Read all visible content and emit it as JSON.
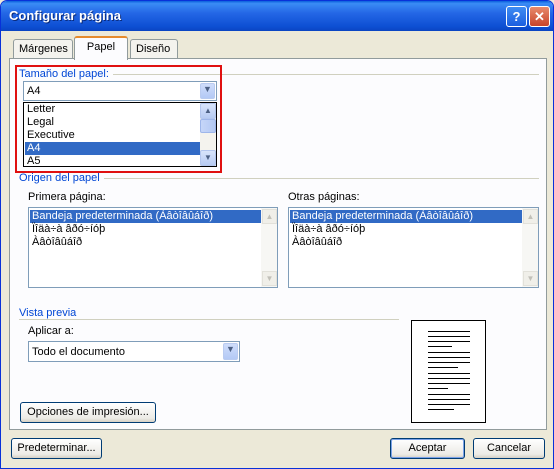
{
  "window": {
    "title": "Configurar página",
    "help_icon": "?",
    "close_icon": "✕"
  },
  "tabs": [
    {
      "label": "Márgenes",
      "active": false
    },
    {
      "label": "Papel",
      "active": true
    },
    {
      "label": "Diseño",
      "active": false
    }
  ],
  "paper_size": {
    "group_label": "Tamaño del papel:",
    "selected": "A4",
    "options": [
      "Letter",
      "Legal",
      "Executive",
      "A4",
      "A5"
    ],
    "selected_option": "A4"
  },
  "paper_source": {
    "group_label": "Origen del papel",
    "first_page_label": "Primera página:",
    "other_pages_label": "Otras páginas:",
    "first_page_items": [
      "Bandeja predeterminada (Àâòîâûáîð)",
      "Ïîäà÷à âðó÷íóþ",
      "Àâòîâûáîð"
    ],
    "other_pages_items": [
      "Bandeja predeterminada (Àâòîâûáîð)",
      "Ïîäà÷à âðó÷íóþ",
      "Àâòîâûáîð"
    ]
  },
  "preview": {
    "group_label": "Vista previa",
    "apply_to_label": "Aplicar a:",
    "apply_to_value": "Todo el documento"
  },
  "buttons": {
    "print_options": "Opciones de impresión...",
    "default": "Predeterminar...",
    "ok": "Aceptar",
    "cancel": "Cancelar"
  },
  "colors": {
    "title_bar": "#0a5fdc",
    "selection": "#316ac5",
    "group_label": "#0046d5",
    "highlight_box": "#e01010"
  }
}
